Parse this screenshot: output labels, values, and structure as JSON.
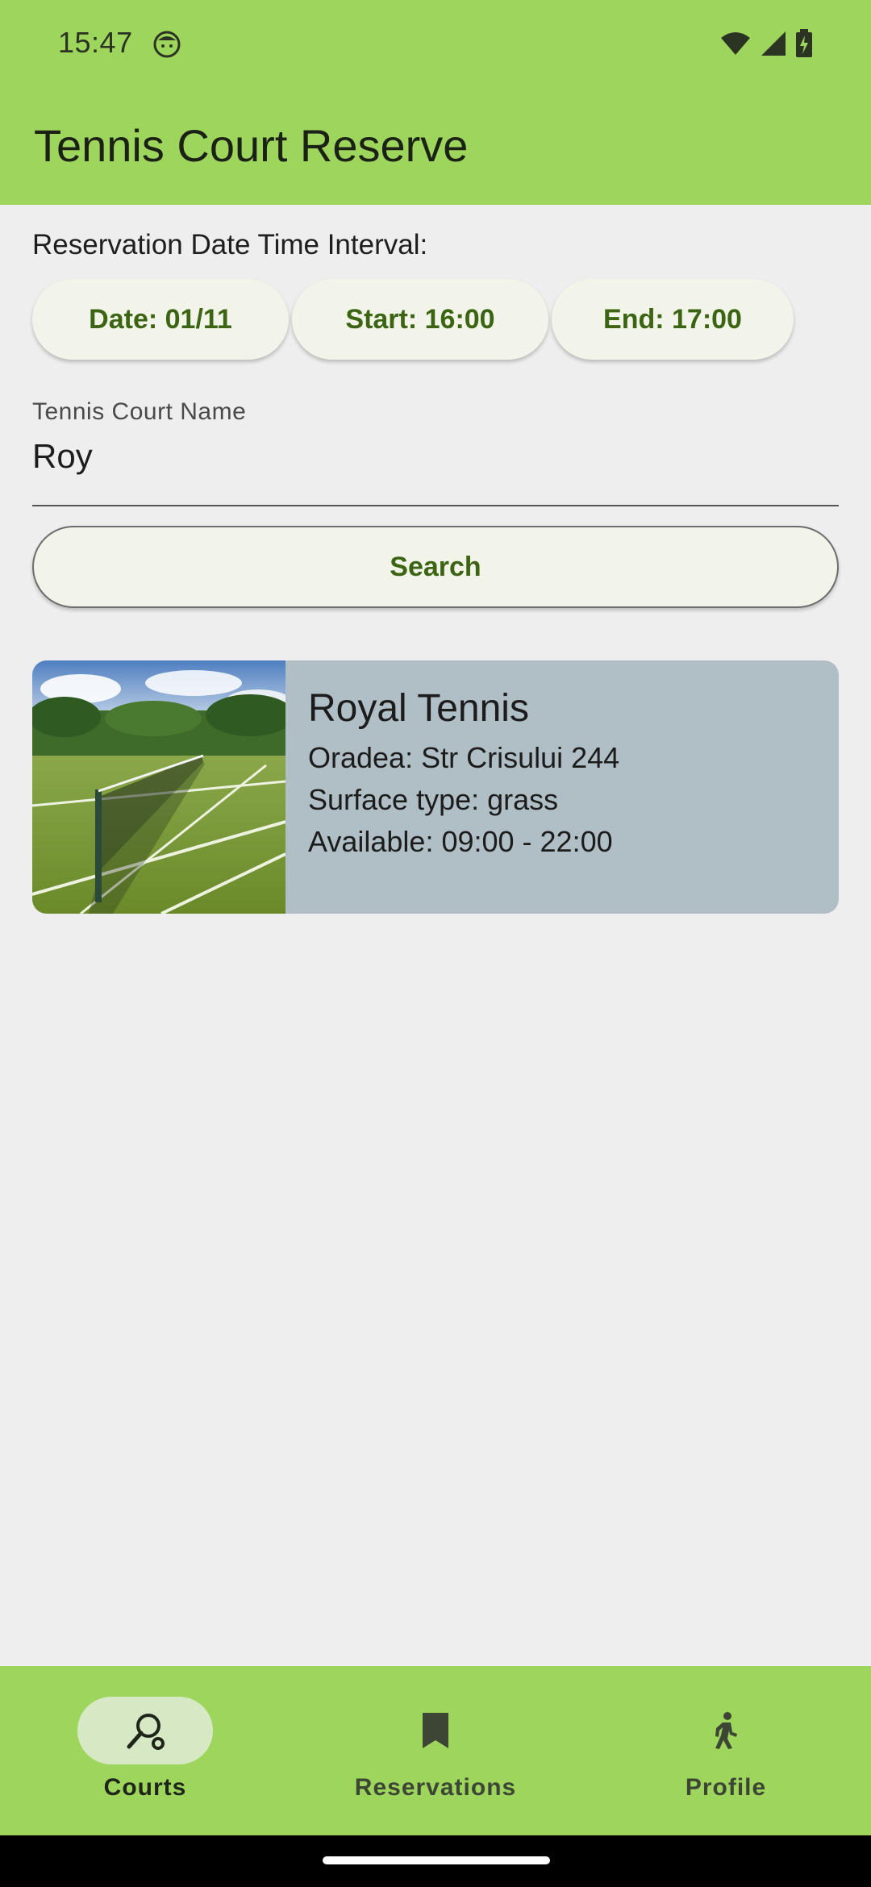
{
  "status_bar": {
    "time": "15:47"
  },
  "app_bar": {
    "title": "Tennis Court Reserve"
  },
  "interval": {
    "label": "Reservation Date Time Interval:",
    "date_chip": "Date: 01/11",
    "start_chip": "Start: 16:00",
    "end_chip": "End: 17:00"
  },
  "court_name_field": {
    "label": "Tennis Court Name",
    "value": "Roy"
  },
  "search_button": {
    "label": "Search"
  },
  "results": [
    {
      "name": "Royal Tennis",
      "address": "Oradea: Str Crisului 244",
      "surface": "Surface type: grass",
      "available": "Available: 09:00 - 22:00",
      "image_icon": "tennis-court-photo"
    }
  ],
  "bottom_nav": {
    "items": [
      {
        "label": "Courts",
        "icon": "tennis-racket-icon",
        "active": true
      },
      {
        "label": "Reservations",
        "icon": "bookmark-icon",
        "active": false
      },
      {
        "label": "Profile",
        "icon": "walking-person-icon",
        "active": false
      }
    ]
  },
  "colors": {
    "primary": "#9ed65d",
    "chip_background": "#f2f4e9",
    "chip_text": "#3b6512",
    "card_background": "#b0bec5",
    "page_background": "#eeeeee",
    "active_pill": "#d7e9c4"
  }
}
